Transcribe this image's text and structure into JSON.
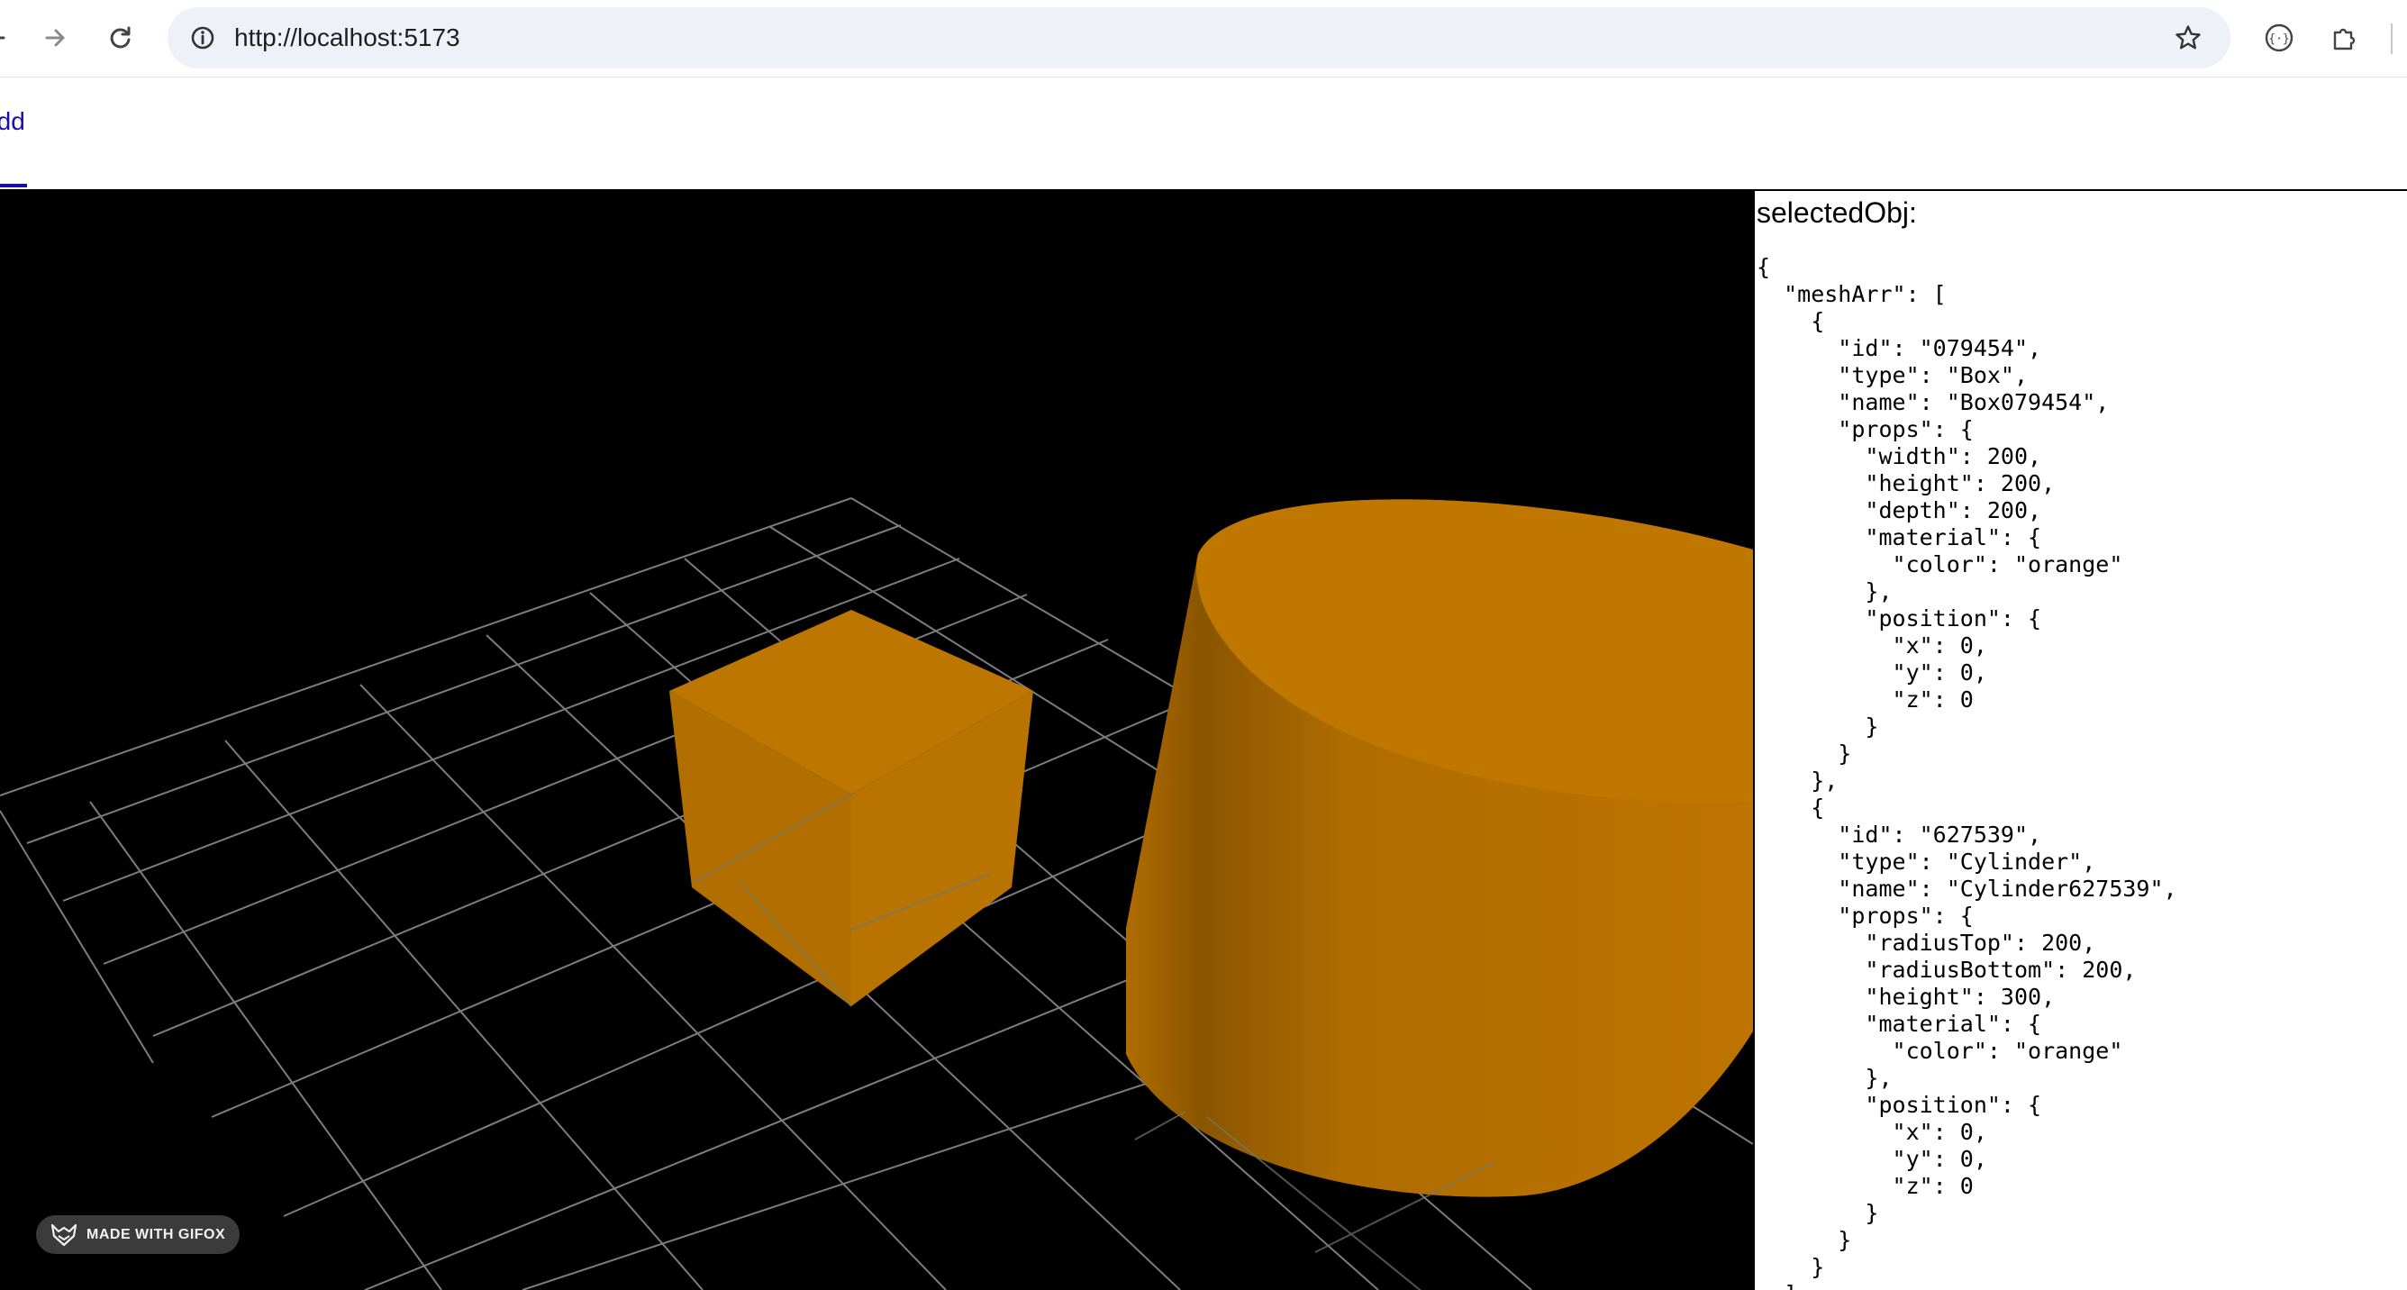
{
  "browser": {
    "url": "http://localhost:5173",
    "icons": {
      "back": "arrow-left-icon",
      "forward": "arrow-right-icon",
      "reload": "reload-icon",
      "site_info": "info-icon",
      "bookmark": "star-icon",
      "extension_a": "code-braces-icon",
      "extensions": "puzzle-icon"
    }
  },
  "toolbar": {
    "add_label": "Add"
  },
  "scene": {
    "background_color": "#000000",
    "grid_color": "#7a7a7a",
    "mesh_color": "#b86f00",
    "meshes": [
      "Box",
      "Cylinder"
    ]
  },
  "watermark": {
    "label": "MADE WITH GIFOX"
  },
  "panel": {
    "title": "selectedObj:",
    "json_text": "{\n  \"meshArr\": [\n    {\n      \"id\": \"079454\",\n      \"type\": \"Box\",\n      \"name\": \"Box079454\",\n      \"props\": {\n        \"width\": 200,\n        \"height\": 200,\n        \"depth\": 200,\n        \"material\": {\n          \"color\": \"orange\"\n        },\n        \"position\": {\n          \"x\": 0,\n          \"y\": 0,\n          \"z\": 0\n        }\n      }\n    },\n    {\n      \"id\": \"627539\",\n      \"type\": \"Cylinder\",\n      \"name\": \"Cylinder627539\",\n      \"props\": {\n        \"radiusTop\": 200,\n        \"radiusBottom\": 200,\n        \"height\": 300,\n        \"material\": {\n          \"color\": \"orange\"\n        },\n        \"position\": {\n          \"x\": 0,\n          \"y\": 0,\n          \"z\": 0\n        }\n      }\n    }\n  ]\n}"
  }
}
